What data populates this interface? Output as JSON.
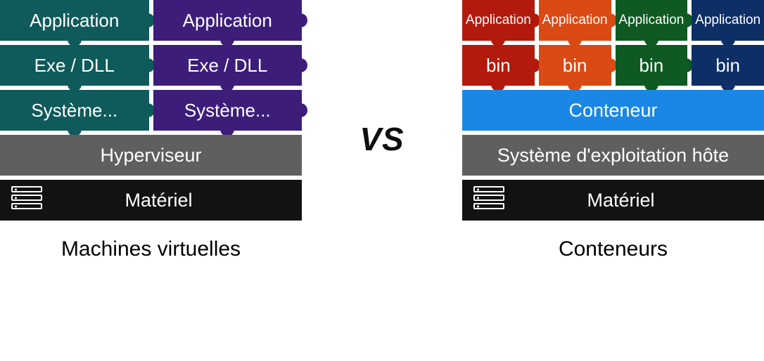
{
  "vs_label": "VS",
  "left": {
    "caption": "Machines virtuelles",
    "vm_columns": [
      {
        "color": "teal",
        "app": "Application",
        "lib": "Exe / DLL",
        "os": "Système..."
      },
      {
        "color": "purple",
        "app": "Application",
        "lib": "Exe / DLL",
        "os": "Système..."
      }
    ],
    "hypervisor": "Hyperviseur",
    "hardware": "Matériel"
  },
  "right": {
    "caption": "Conteneurs",
    "container_columns": [
      {
        "color": "red",
        "app": "Application",
        "lib": "bin"
      },
      {
        "color": "orange",
        "app": "Application",
        "lib": "bin"
      },
      {
        "color": "green",
        "app": "Application",
        "lib": "bin"
      },
      {
        "color": "navy",
        "app": "Application",
        "lib": "bin"
      }
    ],
    "container_engine": "Conteneur",
    "host_os": "Système d'exploitation hôte",
    "hardware": "Matériel"
  }
}
